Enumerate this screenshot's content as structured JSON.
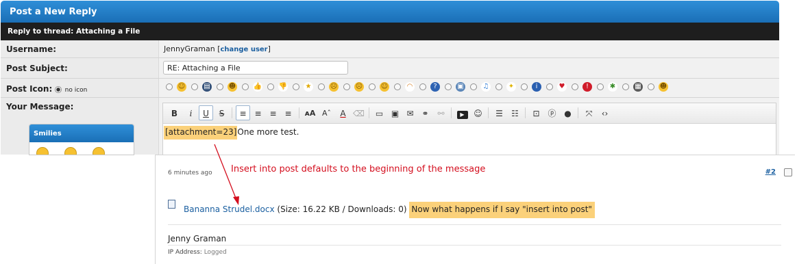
{
  "header": {
    "title": "Post a New Reply"
  },
  "subheader": {
    "title": "Reply to thread: Attaching a File"
  },
  "form": {
    "username_label": "Username:",
    "username": "JennyGraman",
    "change_user_open": "[",
    "change_user": "change user",
    "change_user_close": "]",
    "subject_label": "Post Subject:",
    "subject_value": "RE: Attaching a File",
    "icon_label": "Post Icon:",
    "no_icon": "no icon",
    "message_label": "Your Message:"
  },
  "post_icons": [
    "smile-icon",
    "film-icon",
    "grin-icon",
    "thumbs-up-icon",
    "thumbs-down-icon",
    "star-icon",
    "angry-icon",
    "frown-icon",
    "cool-icon",
    "rainbow-icon",
    "question-icon",
    "image-icon",
    "music-icon",
    "lightbulb-icon",
    "info-icon",
    "heart-icon",
    "exclamation-icon",
    "bug-icon",
    "camera-icon",
    "laugh-icon"
  ],
  "toolbar": {
    "bold": "B",
    "italic": "i",
    "underline": "U",
    "strike": "S"
  },
  "editor": {
    "attachment_tag": "[attachment=23]",
    "text": "One more test."
  },
  "smilies": {
    "title": "Smilies"
  },
  "post": {
    "time": "6 minutes ago",
    "post_no": "#2",
    "annotation": "Insert into post defaults to the beginning of the message",
    "file_name": "Bananna Strudel.docx",
    "file_meta": " (Size: 16.22 KB / Downloads: 0) ",
    "highlight_note": "Now what happens if I say \"insert into post\"",
    "author": "Jenny Graman",
    "ip_label": "IP Address:",
    "ip_value": "Logged"
  },
  "colors": {
    "header_blue": "#1a6fb6",
    "highlight": "#fbd17a",
    "annotation_red": "#d40e1e",
    "link_blue": "#1a5fa0"
  }
}
